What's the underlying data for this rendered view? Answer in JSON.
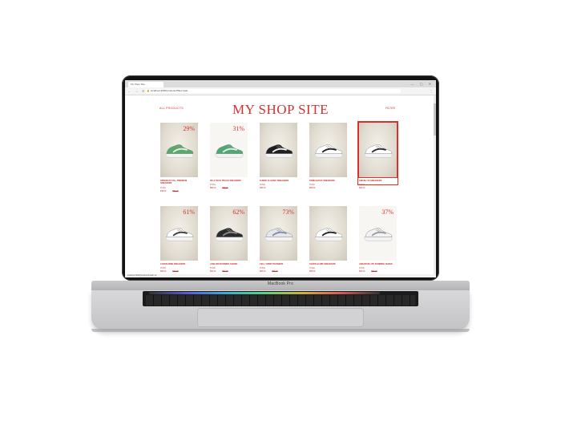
{
  "device": {
    "brand_label": "MacBook Pro"
  },
  "browser": {
    "tab_title": "My Shop Site",
    "url": "localhost:3000/products?filter=sale",
    "window_controls": "— ▢ ✕",
    "nav_icons": "← → ⟳",
    "menu_icon": "⋮"
  },
  "site": {
    "nav_left": "ALL PRODUCTS",
    "title": "MY SHOP SITE",
    "nav_right": "FILTER"
  },
  "products": [
    {
      "name": "SPEEDCAT OG+ PREMIUM SNEAKERS",
      "brand": "PUMA",
      "price": "$48.00",
      "old_price": "$67.00",
      "discount": "29%",
      "bg": "beige",
      "shoe_color": "#5aa86a",
      "accent": "#e6f3e6"
    },
    {
      "name": "RS-X TECH TRACK SNEAKERS",
      "brand": "PUMA",
      "price": "$68.00",
      "old_price": "$98.00",
      "discount": "31%",
      "bg": "white",
      "shoe_color": "#4fa873",
      "accent": "#dff2e4"
    },
    {
      "name": "SUEDE CLASSIC SNEAKERS",
      "brand": "PUMA",
      "price": "$45.00",
      "old_price": "",
      "discount": "",
      "bg": "beige",
      "shoe_color": "#1f1f1f",
      "accent": "#f5f5f5"
    },
    {
      "name": "ROMA BASIC SNEAKERS",
      "brand": "PUMA",
      "price": "$55.00",
      "old_price": "",
      "discount": "",
      "bg": "beige",
      "shoe_color": "#ffffff",
      "accent": "#1f1f1f"
    },
    {
      "name": "SMASH V2 SNEAKERS",
      "brand": "PUMA",
      "price": "$60.00",
      "old_price": "",
      "discount": "",
      "bg": "beige",
      "shoe_color": "#ffffff",
      "accent": "#2a2a2a",
      "selected": true
    },
    {
      "name": "CAVEN DIME SNEAKERS",
      "brand": "PUMA",
      "price": "$28.00",
      "old_price": "$72.00",
      "discount": "61%",
      "bg": "beige",
      "shoe_color": "#ffffff",
      "accent": "#3a3a3a"
    },
    {
      "name": "AXELION RUNNING SHOES",
      "brand": "PUMA",
      "price": "$30.00",
      "old_price": "$80.00",
      "discount": "62%",
      "bg": "beige",
      "shoe_color": "#2b2b2b",
      "accent": "#8a8a8a"
    },
    {
      "name": "CELL VIPER TRAINERS",
      "brand": "PUMA",
      "price": "$25.00",
      "old_price": "$95.00",
      "discount": "73%",
      "bg": "beige",
      "shoe_color": "#e6e6ea",
      "accent": "#7c8ea8"
    },
    {
      "name": "SHUFFLE MID SNEAKERS",
      "brand": "PUMA",
      "price": "$58.00",
      "old_price": "",
      "discount": "",
      "bg": "beige",
      "shoe_color": "#ffffff",
      "accent": "#222222"
    },
    {
      "name": "ANZARUN LITE RUNNING SHOES",
      "brand": "PUMA",
      "price": "$40.00",
      "old_price": "$64.00",
      "discount": "37%",
      "bg": "white",
      "shoe_color": "#f2f2f2",
      "accent": "#9a9a9a"
    }
  ],
  "status_bar": "localhost:3000/products/smash-v2",
  "colors": {
    "accent": "#d6312f"
  }
}
